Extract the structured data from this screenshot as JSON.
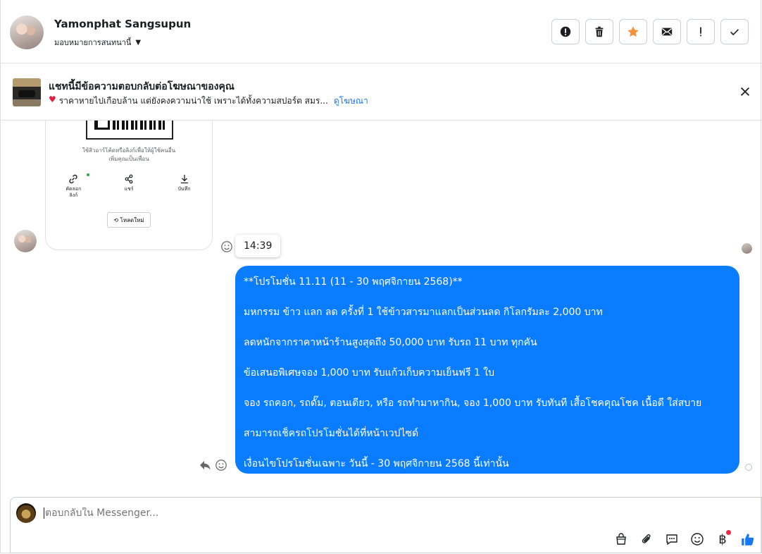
{
  "header": {
    "name": "Yamonphat Sangsupun",
    "assign_label": "มอบหมายการสนทนานี้",
    "actions": [
      "report-icon",
      "trash-icon",
      "star-icon",
      "mail-icon",
      "exclamation-icon",
      "check-icon"
    ]
  },
  "banner": {
    "title": "แชทนี้มีข้อความตอบกลับต่อโฆษณาของคุณ",
    "ad_text": "ราคาหายไปเกือบล้าน แต่ยังคงความน่าใช้ เพราะได้ทั้งความสปอร์ต สมร...",
    "link": "ดูโฆษณา"
  },
  "card": {
    "hint_line1": "ใช้สิวอาร์โค้ดหรือลิงก์เพื่อให้ผู้ใช้คนอื่น",
    "hint_line2": "เพิ่มคุณเป็นเพื่อน",
    "copy_label_1": "คัดลอก",
    "copy_label_2": "ลิงก์",
    "share_label": "แชร์",
    "save_label": "บันทึก",
    "reload_label": "⟲ โหลดใหม่"
  },
  "tooltip_time": "14:39",
  "message": {
    "lines": [
      "**โปรโมชั่น 11.11  (11 - 30 พฤศจิกายน 2568)**",
      "มหกรรม ข้าว แลก ลด ครั้งที่ 1 ใช้ข้าวสารมาแลกเป็นส่วนลด กิโลกรัมละ 2,000 บาท",
      "ลดหนักจากราคาหน้าร้านสูงสุดถึง 50,000 บาท รับรถ 11 บาท ทุกคัน",
      "ข้อเสนอพิเศษจอง 1,000 บาท รับแก้วเก็บความเย็นฟรี 1 ใบ",
      "จอง รถคอก, รถดั๊ม, ตอนเดียว, หรือ รถทำมาหากิน, จอง 1,000 บาท รับทันที เสื้อโชคคุณโชค เนื้อดี ใส่สบาย",
      "สามารถเช็ครถโปรโมชั่นได้ที่หน้าเวปไซด์",
      "เงื่อนไขโปรโมชั่นเฉพาะ วันนี้ - 30 พฤศจิกายน 2568 นี้เท่านั้น"
    ]
  },
  "composer": {
    "placeholder": "ตอบกลับใน Messenger...",
    "tools": [
      "bag-icon",
      "paperclip-icon",
      "saved-reply-icon",
      "emoji-icon",
      "baht-icon",
      "like-icon"
    ],
    "baht_symbol": "฿"
  },
  "colors": {
    "bubble": "#0a7cff",
    "link": "#1877f2",
    "star": "#f7923b",
    "like": "#1877f2"
  }
}
